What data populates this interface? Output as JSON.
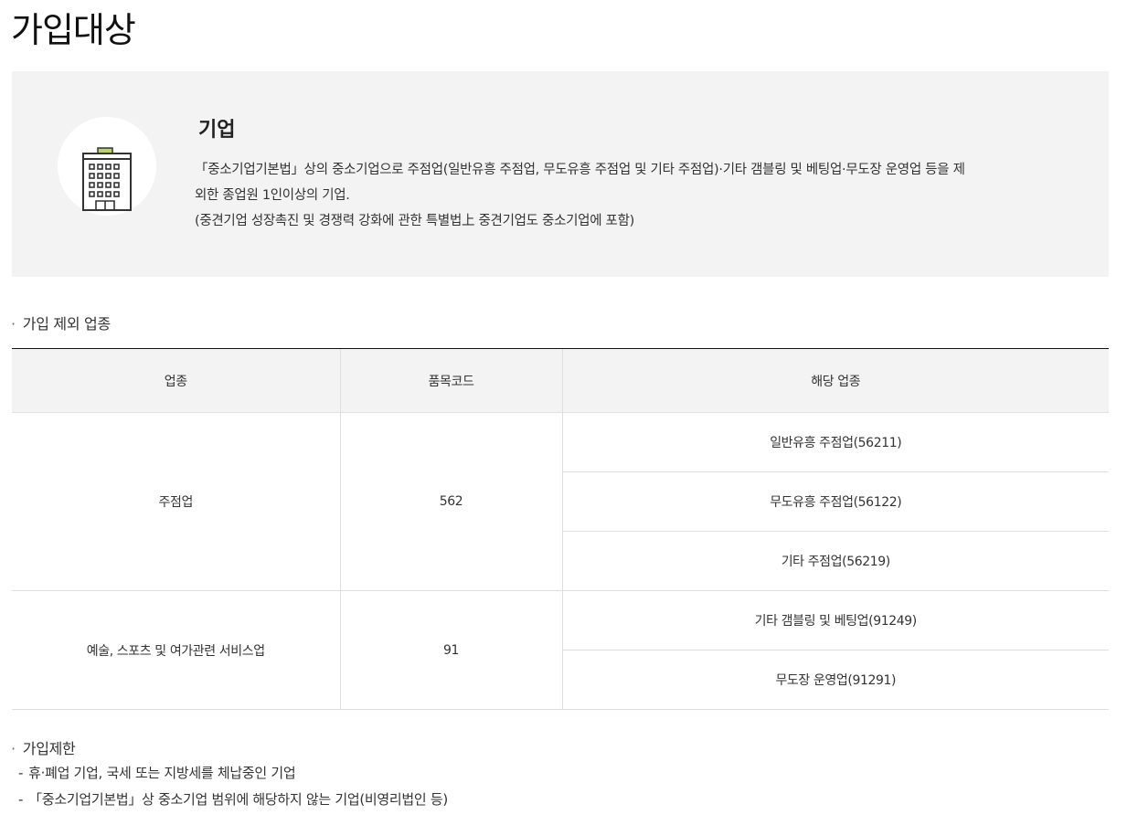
{
  "page_title": "가입대상",
  "target": {
    "icon": "building-icon",
    "title": "기업",
    "description_lines": [
      "「중소기업기본법」상의 중소기업으로 주점업(일반유흥 주점업, 무도유흥 주점업 및 기타 주점업)·기타 갬블링 및 베팅업·무도장 운영업 등을 제",
      "외한 종업원 1인이상의 기업.",
      "(중견기업 성장촉진 및 경쟁력 강화에 관한 특별법上 중견기업도 중소기업에 포함)"
    ]
  },
  "exclusion": {
    "heading": "가입 제외 업종",
    "columns": [
      "업종",
      "품목코드",
      "해당 업종"
    ],
    "groups": [
      {
        "industry": "주점업",
        "code": "562",
        "items": [
          "일반유흥 주점업(56211)",
          "무도유흥 주점업(56122)",
          "기타 주점업(56219)"
        ]
      },
      {
        "industry": "예술, 스포츠 및 여가관련 서비스업",
        "code": "91",
        "items": [
          "기타 갬블링 및 베팅업(91249)",
          "무도장 운영업(91291)"
        ]
      }
    ]
  },
  "limitation": {
    "heading": "가입제한",
    "items": [
      "휴·폐업 기업, 국세 또는 지방세를 체납중인 기업",
      "「중소기업기본법」상 중소기업 범위에 해당하지 않는 기업(비영리법인 등)"
    ]
  }
}
